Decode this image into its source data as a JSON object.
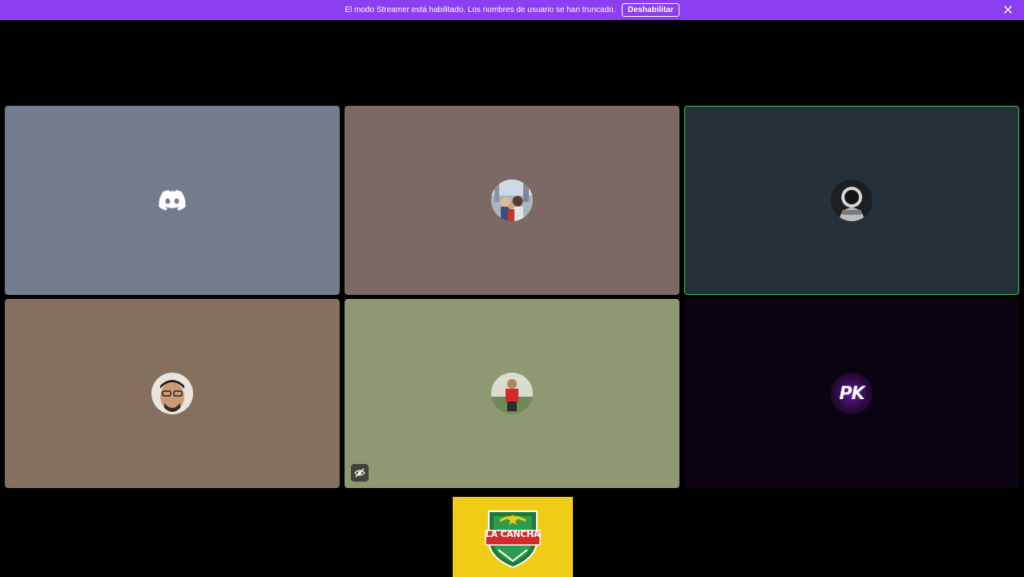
{
  "banner": {
    "message": "El modo Streamer está habilitado. Los nombres de usuario se han truncado.",
    "button_label": "Deshabilitar",
    "color": "#8c3ff0"
  },
  "participants": [
    {
      "avatar": "discord-logo-icon",
      "bg": "#737c8f",
      "speaking": false
    },
    {
      "avatar": "group-photo-avatar",
      "bg": "#7c6963",
      "speaking": false
    },
    {
      "avatar": "astronaut-avatar",
      "bg": "#263039",
      "speaking": true
    },
    {
      "avatar": "man-glasses-avatar",
      "bg": "#85705f",
      "speaking": false
    },
    {
      "avatar": "man-red-shirt-avatar",
      "bg": "#8e9873",
      "speaking": false,
      "video_hidden": true
    },
    {
      "avatar": "pk-logo-avatar",
      "avatar_text": "PK",
      "bg": "#0b0312",
      "speaking": false
    }
  ],
  "stream_logo": {
    "text": "LA CANCHA",
    "bg": "#f0cc16"
  },
  "colors": {
    "speaking_ring": "#3ec45c"
  }
}
